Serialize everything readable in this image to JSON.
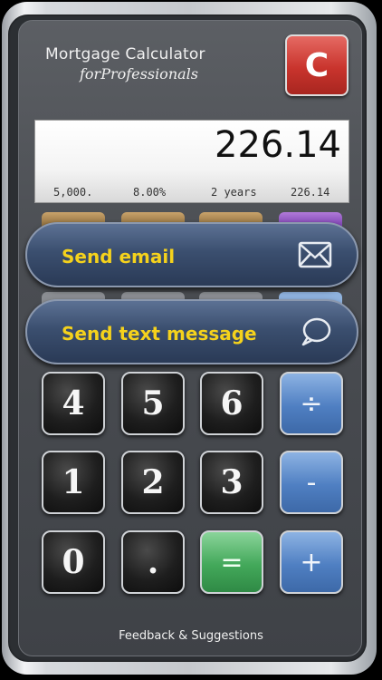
{
  "header": {
    "title": "Mortgage Calculator",
    "subtitle": "forProfessionals",
    "clear_label": "C"
  },
  "display": {
    "value": "226.14",
    "principal": "5,000.",
    "rate": "8.00%",
    "term": "2 years",
    "payment": "226.14"
  },
  "actions": {
    "send_email": "Send email",
    "send_text": "Send text message"
  },
  "keypad": {
    "k4": "4",
    "k5": "5",
    "k6": "6",
    "divide": "÷",
    "k1": "1",
    "k2": "2",
    "k3": "3",
    "minus": "-",
    "k0": "0",
    "dot": ".",
    "equals": "=",
    "plus": "+"
  },
  "footer": {
    "feedback": "Feedback  & Suggestions"
  },
  "colors": {
    "accent_yellow": "#f5d21c",
    "clear_red": "#c9342d",
    "operator_blue": "#4f7fc2",
    "equals_green": "#43a85a"
  },
  "icons": {
    "email": "envelope-icon",
    "text": "speech-bubble-icon"
  }
}
